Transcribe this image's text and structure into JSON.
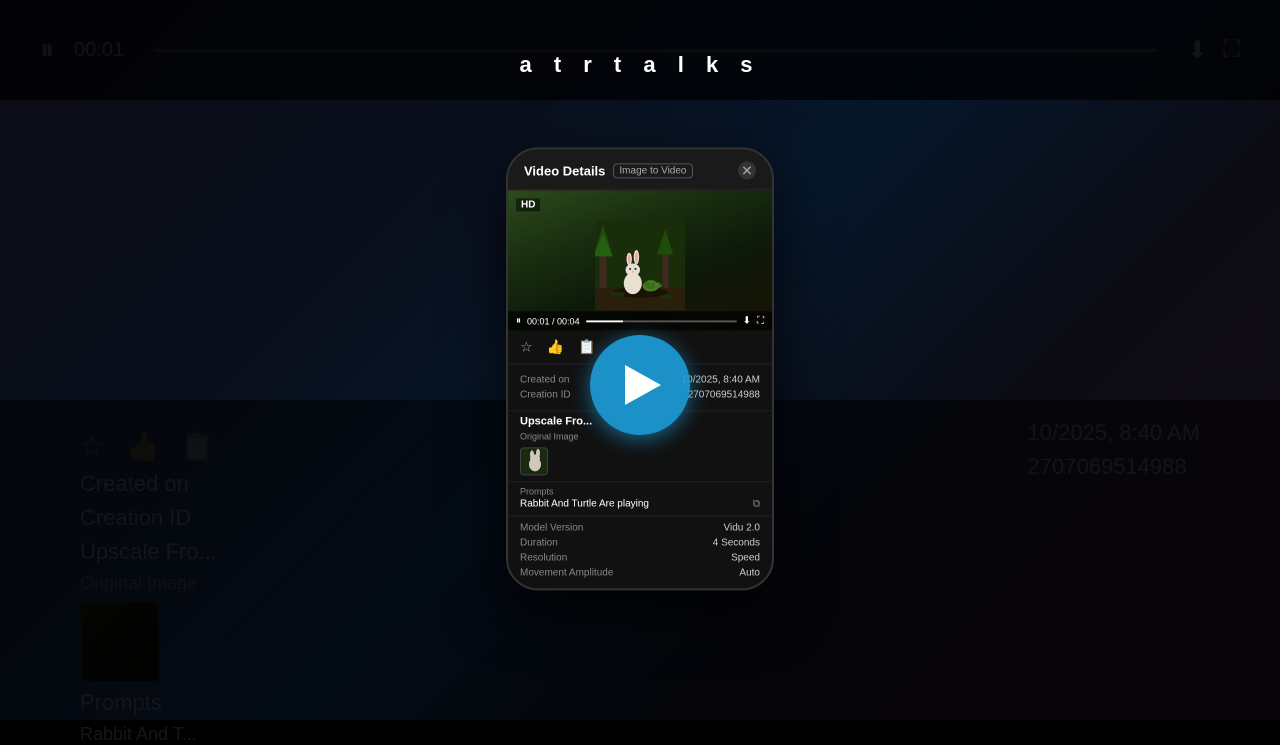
{
  "app": {
    "channel_title": "a t r  t a l k s"
  },
  "bg": {
    "topbar": {
      "pause_icon": "⏸",
      "time": "00:01",
      "download_icon": "⬇",
      "expand_icon": "⛶"
    },
    "left": {
      "labels": [
        "Created on",
        "Creation ID",
        "Upscale Fro...",
        "Original Image",
        "Prompts",
        "Rabbit And T..."
      ],
      "values": [
        "",
        "",
        "",
        "",
        "",
        ""
      ]
    },
    "right": {
      "date": "10/2025, 8:40 AM",
      "id": "2707069514988"
    }
  },
  "modal": {
    "title": "Video Details",
    "badge": "Image to Video",
    "close_icon": "✕",
    "video": {
      "hd_label": "HD",
      "time_current": "00:01",
      "time_total": "00:04"
    },
    "action_icons": [
      "☆",
      "👍",
      "📋"
    ],
    "details": {
      "created_on_label": "Created on",
      "created_on_value": "10/2025, 8:40 AM",
      "creation_id_label": "Creation ID",
      "creation_id_value": "2707069514988"
    },
    "upscale": {
      "title": "Upscale Fro...",
      "sub_label": "Original Image"
    },
    "prompts": {
      "label": "Prompts",
      "text": "Rabbit And Turtle Are playing",
      "copy_icon": "⧉"
    },
    "model": {
      "model_version_label": "Model Version",
      "model_version_value": "Vidu 2.0",
      "duration_label": "Duration",
      "duration_value": "4 Seconds",
      "resolution_label": "Resolution",
      "resolution_value": "Speed",
      "movement_label": "Movement Amplitude",
      "movement_value": "Auto"
    }
  },
  "play_button": {
    "label": "play"
  }
}
